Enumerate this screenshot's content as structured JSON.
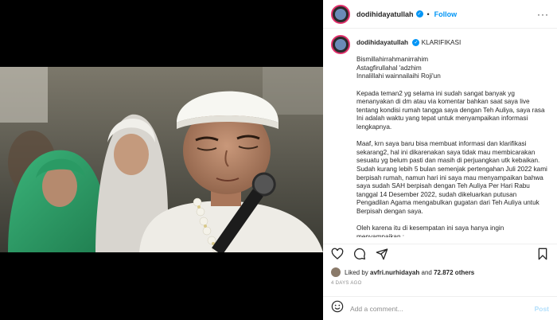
{
  "header": {
    "username": "dodihidayatullah",
    "dot": "•",
    "follow_label": "Follow",
    "more_label": "···"
  },
  "caption": {
    "username": "dodihidayatullah",
    "tag": "KLARIFIKASI",
    "lines": [
      "Bismillahirrahmanirrahim",
      "Astagfirullahal 'adzhim",
      "Innalillahi wainnailaihi Roji'un"
    ],
    "para1": "Kepada teman2 yg selama ini sudah sangat banyak yg menanyakan di dm atau via komentar bahkan saat saya live tentang kondisi rumah tangga saya dengan Teh Auliya, saya rasa Ini adalah waktu yang tepat untuk menyampaikan informasi lengkapnya.",
    "para2": "Maaf, krn saya baru bisa membuat informasi dan klarifikasi sekarang2, hal ini dikarenakan saya tidak mau membicarakan sesuatu yg belum pasti dan masih di perjuangkan utk kebaikan. Sudah kurang lebih 5 bulan semenjak pertengahan Juli 2022 kami berpisah rumah, namun hari ini saya mau menyampaikan bahwa saya sudah SAH berpisah dengan Teh Auliya Per Hari Rabu tanggal 14 Desember 2022, sudah dikeluarkan putusan Pengadilan Agama mengabulkan gugatan dari Teh Auliya untuk Berpisah dengan saya.",
    "para3": "Oleh karena itu di kesempatan ini saya hanya ingin menyampaikan :"
  },
  "likes": {
    "prefix": "Liked by",
    "user": "avfri.nurhidayah",
    "and": "and",
    "others": "72.872 others"
  },
  "timestamp": "4 DAYS AGO",
  "comment": {
    "placeholder": "Add a comment...",
    "post_label": "Post"
  },
  "colors": {
    "accent": "#0095f6",
    "ring": "#e1306c",
    "post_disabled": "#b2dffc"
  }
}
